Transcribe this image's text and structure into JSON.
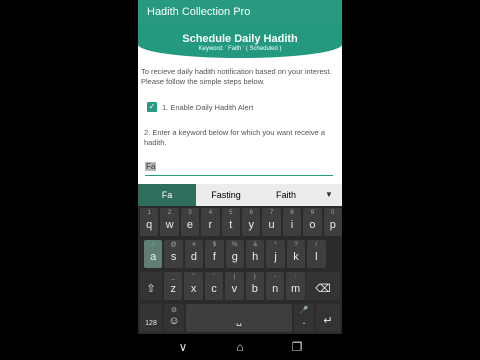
{
  "app": {
    "title": "Hadith Collection Pro"
  },
  "header": {
    "title": "Schedule Daily Hadith",
    "subtitle": "Keyword: ' Faith ' ( Scheduled )"
  },
  "content": {
    "intro": "To recieve daily hadith notification based on your interest. Please follow the simple steps below.",
    "checkbox_label": "1. Enable Daily Hadith Alert",
    "checkbox_checked": true,
    "step2": "2. Enter a keyword below for which you want receive a hadith.",
    "keyword_value": "Fa"
  },
  "suggestions": [
    "Fa",
    "Fasting",
    "Faith"
  ],
  "keyboard": {
    "row1": [
      {
        "k": "q",
        "a": "1"
      },
      {
        "k": "w",
        "a": "2"
      },
      {
        "k": "e",
        "a": "3"
      },
      {
        "k": "r",
        "a": "4"
      },
      {
        "k": "t",
        "a": "5"
      },
      {
        "k": "y",
        "a": "6"
      },
      {
        "k": "u",
        "a": "7"
      },
      {
        "k": "i",
        "a": "8"
      },
      {
        "k": "o",
        "a": "9"
      },
      {
        "k": "p",
        "a": "0"
      }
    ],
    "row2": [
      {
        "k": "a",
        "a": "!"
      },
      {
        "k": "s",
        "a": "@"
      },
      {
        "k": "d",
        "a": "#"
      },
      {
        "k": "f",
        "a": "$"
      },
      {
        "k": "g",
        "a": "%"
      },
      {
        "k": "h",
        "a": "&"
      },
      {
        "k": "j",
        "a": "*"
      },
      {
        "k": "k",
        "a": "?"
      },
      {
        "k": "l",
        "a": "/"
      }
    ],
    "row3": [
      {
        "k": "z",
        "a": "_"
      },
      {
        "k": "x",
        "a": "\""
      },
      {
        "k": "c",
        "a": "'"
      },
      {
        "k": "v",
        "a": "("
      },
      {
        "k": "b",
        "a": ")"
      },
      {
        "k": "n",
        "a": "-"
      },
      {
        "k": "m",
        "a": ":"
      }
    ],
    "shift_icon": "⇧",
    "backspace_icon": "⌫",
    "numbers_label": "128",
    "emoji_icon": "☺",
    "settings_icon": "⚙",
    "mic_icon": "🎤",
    "period_label": ".",
    "enter_icon": "↵",
    "space_icon": "␣",
    "active_key": "a"
  },
  "nav": {
    "back_icon": "∨",
    "home_icon": "⌂",
    "recents_icon": "❐"
  }
}
